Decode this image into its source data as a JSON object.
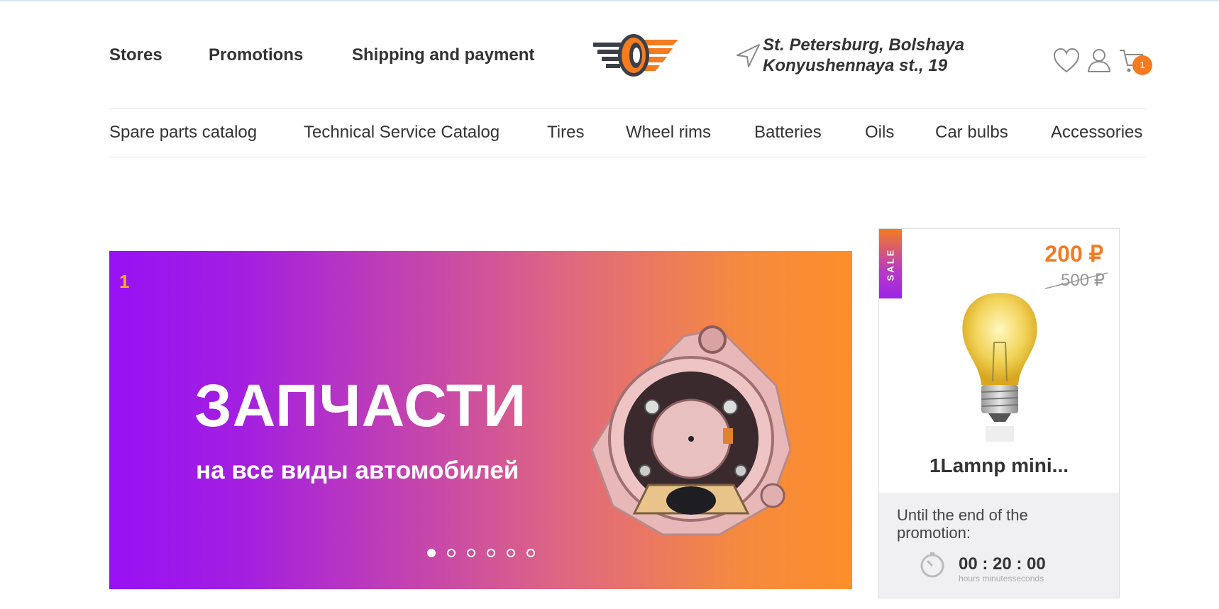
{
  "header": {
    "nav": [
      "Stores",
      "Promotions",
      "Shipping and payment"
    ],
    "address_line1": "St. Petersburg, Bolshaya",
    "address_line2": "Konyushennaya st., 19",
    "cart_count": "1",
    "colors": {
      "accent": "#f47b20",
      "purple": "#9711f5",
      "text": "#333333"
    },
    "icons": [
      "logo-icon",
      "location-arrow-icon",
      "heart-icon",
      "user-icon",
      "cart-icon"
    ]
  },
  "catalog_menu": [
    "Spare parts catalog",
    "Technical Service Catalog",
    "Tires",
    "Wheel rims",
    "Batteries",
    "Oils",
    "Car bulbs",
    "Accessories"
  ],
  "banner": {
    "slide_number": "1",
    "title": "ЗАПЧАСТИ",
    "subtitle": "на все виды автомобилей",
    "slide_count": 6,
    "active_slide": 1
  },
  "sale_card": {
    "tag": "SALE",
    "price_new": "200 ₽",
    "price_old": "500 ₽",
    "product_name": "1Lamnp mini...",
    "timer_label": "Until the end of the promotion:",
    "timer_value": "00 : 20 : 00",
    "timer_units": "hours minutesseconds"
  }
}
